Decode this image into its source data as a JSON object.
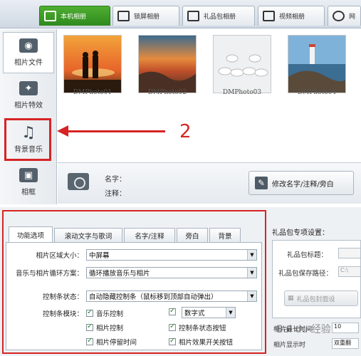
{
  "tabs": [
    {
      "label": "本机相册",
      "active": true
    },
    {
      "label": "锁屏相册",
      "active": false
    },
    {
      "label": "礼品包相册",
      "active": false
    },
    {
      "label": "视频相册",
      "active": false
    },
    {
      "label": "网",
      "active": false
    }
  ],
  "sidebar": {
    "items": [
      {
        "label": "相片文件"
      },
      {
        "label": "相片特效"
      },
      {
        "label": "背景音乐"
      },
      {
        "label": "相框"
      }
    ]
  },
  "photos": [
    {
      "name": "DMPhoto01"
    },
    {
      "name": "DMPhoto02"
    },
    {
      "name": "DMPhoto03"
    },
    {
      "name": "DMPhoto04"
    }
  ],
  "annotation": {
    "number": "2"
  },
  "info": {
    "name_label": "名字：",
    "note_label": "注释：",
    "edit_button": "修改名字/注释/旁白"
  },
  "options_tabs": [
    "功能选项",
    "滚动文字与歌词",
    "名字/注释",
    "旁白",
    "背景"
  ],
  "options": {
    "area_size_label": "相片区域大小：",
    "area_size_value": "中屏幕",
    "loop_label": "音乐与相片循环方案：",
    "loop_value": "循环播放音乐与相片",
    "control_state_label": "控制条状态：",
    "control_state_value": "自动隐藏控制条（鼠标移到顶部自动弹出）",
    "control_module_label": "控制条模块：",
    "checkboxes": [
      {
        "label": "音乐控制",
        "checked": true
      },
      {
        "label": "数字式",
        "checked": true
      },
      {
        "label": "相片控制",
        "checked": true
      },
      {
        "label": "控制条状态按钮",
        "checked": true
      },
      {
        "label": "相片停留时间",
        "checked": true
      },
      {
        "label": "相片效果开关按钮",
        "checked": true
      }
    ]
  },
  "gift": {
    "title": "礼品包专项设置：",
    "title_label": "礼品包标题：",
    "path_label": "礼品包保存路径：",
    "path_value": "C:\\",
    "button": "礼品包封面设",
    "bottom_label_1": "相片最长时间",
    "bottom_value_1": "10",
    "bottom_label_2": "相片显示时",
    "bottom_value_2": "双重翻"
  },
  "watermark": "Bai du 经验"
}
